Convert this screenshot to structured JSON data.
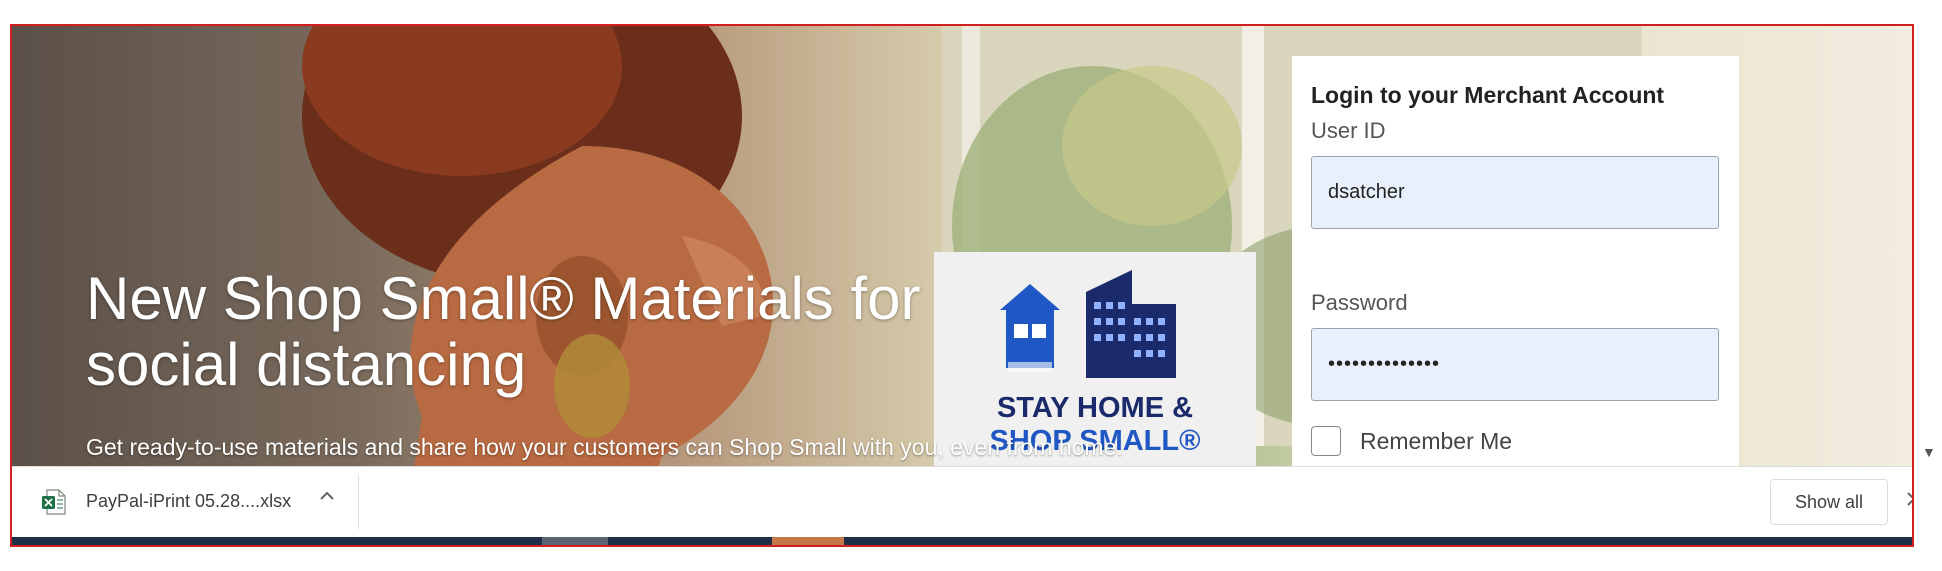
{
  "hero": {
    "title": "New Shop Small® Materials for social distancing",
    "subtitle": "Get ready-to-use materials and share how your customers can Shop Small with you, even from home."
  },
  "promo": {
    "line1": "STAY HOME &",
    "line2": "SHOP SMALL®"
  },
  "login": {
    "heading": "Login to your Merchant Account",
    "user_id_label": "User ID",
    "user_id_value": "dsatcher",
    "password_label": "Password",
    "password_value": "••••••••••••••",
    "remember_label": "Remember Me"
  },
  "download_bar": {
    "file_name": "PayPal-iPrint 05.28....xlsx",
    "show_all_label": "Show all",
    "file_icon": "excel-file-icon"
  },
  "colors": {
    "frame_border": "#d11f1f",
    "input_bg": "#e8f0fe",
    "promo_navy": "#1b2a6b",
    "promo_blue": "#1f57c4"
  }
}
